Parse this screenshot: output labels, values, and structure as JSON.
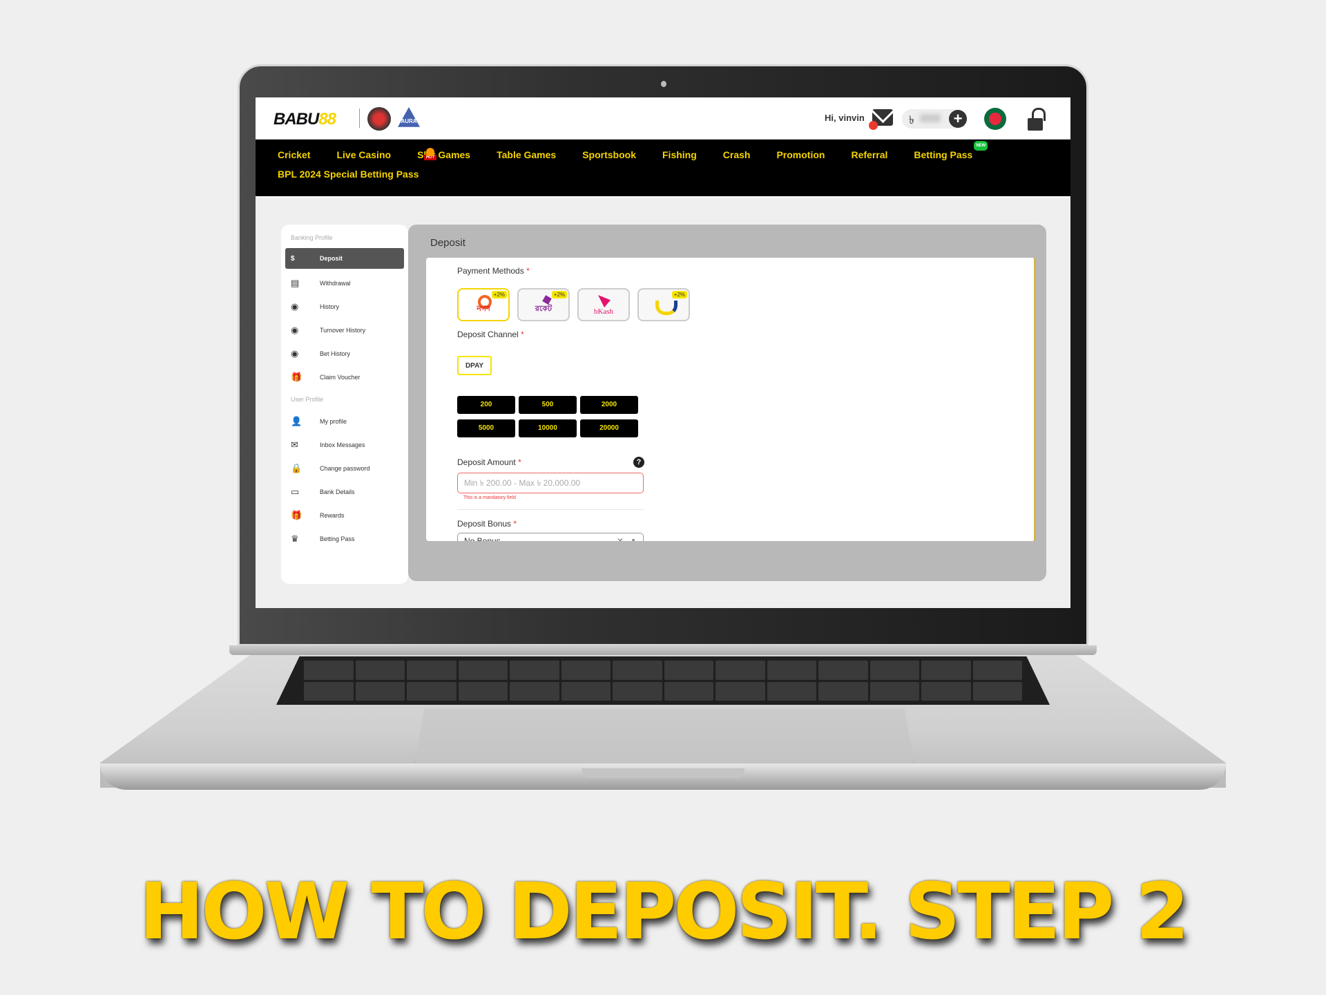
{
  "header": {
    "brand": "BABU",
    "brand_accent": "88",
    "team_badge_2": "AURA",
    "greeting": "Hi, vinvin",
    "currency_symbol": "৳",
    "add_funds_icon": "plus-circle-icon",
    "mail_icon": "envelope-icon",
    "flag_icon": "bangladesh-flag-icon",
    "logout_icon": "unlock-icon"
  },
  "nav": {
    "items": [
      {
        "label": "Cricket"
      },
      {
        "label": "Live Casino"
      },
      {
        "label": "Slot Games",
        "badge": "HOT"
      },
      {
        "label": "Table Games"
      },
      {
        "label": "Sportsbook"
      },
      {
        "label": "Fishing"
      },
      {
        "label": "Crash"
      },
      {
        "label": "Promotion"
      },
      {
        "label": "Referral"
      },
      {
        "label": "Betting Pass",
        "badge": "NEW"
      },
      {
        "label": "BPL 2024 Special Betting Pass"
      }
    ]
  },
  "sidebar": {
    "banking_title": "Banking Profile",
    "banking_items": [
      {
        "label": "Deposit",
        "icon": "$",
        "active": true
      },
      {
        "label": "Withdrawal",
        "icon": "▤"
      },
      {
        "label": "History",
        "icon": "◉"
      },
      {
        "label": "Turnover History",
        "icon": "◉"
      },
      {
        "label": "Bet History",
        "icon": "◉"
      },
      {
        "label": "Claim Voucher",
        "icon": "🎁"
      }
    ],
    "user_title": "User Profile",
    "user_items": [
      {
        "label": "My profile",
        "icon": "👤"
      },
      {
        "label": "Inbox Messages",
        "icon": "✉"
      },
      {
        "label": "Change password",
        "icon": "🔒"
      },
      {
        "label": "Bank Details",
        "icon": "▭"
      },
      {
        "label": "Rewards",
        "icon": "🎁"
      },
      {
        "label": "Betting Pass",
        "icon": "♛"
      }
    ]
  },
  "deposit": {
    "title": "Deposit",
    "payment_methods_label": "Payment Methods",
    "required_mark": "*",
    "payment_methods": [
      {
        "name": "নগদ",
        "bonus": "+2%",
        "selected": true,
        "color": "#e2231a"
      },
      {
        "name": "রকেট",
        "bonus": "+2%",
        "selected": false,
        "color": "#8c2a9c"
      },
      {
        "name": "bKash",
        "bonus": "",
        "selected": false,
        "color": "#e2136e"
      },
      {
        "name": "U",
        "bonus": "+2%",
        "selected": false,
        "color": "#1c3f94"
      }
    ],
    "channel_label": "Deposit Channel",
    "channel": "DPAY",
    "amount_presets": [
      "200",
      "500",
      "2000",
      "5000",
      "10000",
      "20000"
    ],
    "amount_label": "Deposit Amount",
    "amount_placeholder": "Min ৳ 200.00 - Max ৳ 20,000.00",
    "amount_value": "",
    "amount_error": "This is a mandatory field",
    "help_icon": "?",
    "bonus_label": "Deposit Bonus",
    "bonus_value": "No Bonus",
    "bonus_clear": "✕",
    "bonus_caret": "▼"
  },
  "caption": "HOW TO DEPOSIT. STEP 2",
  "colors": {
    "accent": "#f5d400",
    "nav_bg": "#000000",
    "error": "#ee3333",
    "new_badge": "#16c13a"
  }
}
